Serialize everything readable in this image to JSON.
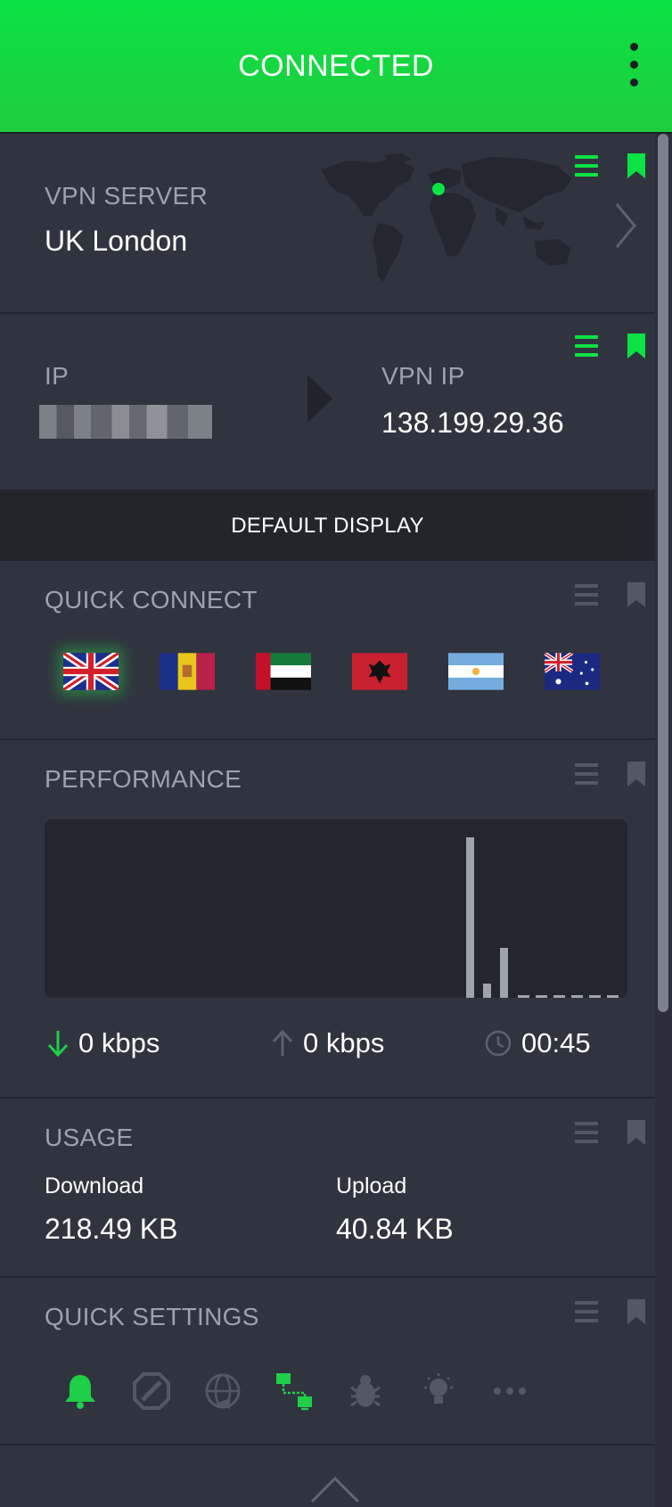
{
  "header": {
    "title": "CONNECTED"
  },
  "vpn_server": {
    "label": "VPN SERVER",
    "value": "UK London"
  },
  "ip": {
    "label": "IP",
    "vpn_label": "VPN IP",
    "vpn_value": "138.199.29.36"
  },
  "default_display": {
    "label": "DEFAULT DISPLAY"
  },
  "quick_connect": {
    "label": "QUICK CONNECT",
    "flags": [
      "uk-flag",
      "andorra-flag",
      "uae-flag",
      "albania-flag",
      "argentina-flag",
      "australia-flag"
    ]
  },
  "performance": {
    "label": "PERFORMANCE",
    "download": "0 kbps",
    "upload": "0 kbps",
    "time": "00:45",
    "chart_data": {
      "type": "bar",
      "values": [
        0.9,
        0.08,
        0.28,
        0.02,
        0.02,
        0.02,
        0.02,
        0.02,
        0.02
      ]
    }
  },
  "usage": {
    "label": "USAGE",
    "download_label": "Download",
    "download_value": "218.49 KB",
    "upload_label": "Upload",
    "upload_value": "40.84 KB"
  },
  "quick_settings": {
    "label": "QUICK SETTINGS",
    "icons": [
      "bell-icon",
      "block-icon",
      "globe-icon",
      "network-icon",
      "bug-icon",
      "bulb-icon",
      "more-icon"
    ]
  },
  "colors": {
    "accent": "#0be243",
    "card": "#30343f",
    "muted": "#9da2ad",
    "icon_gray": "#545863"
  }
}
